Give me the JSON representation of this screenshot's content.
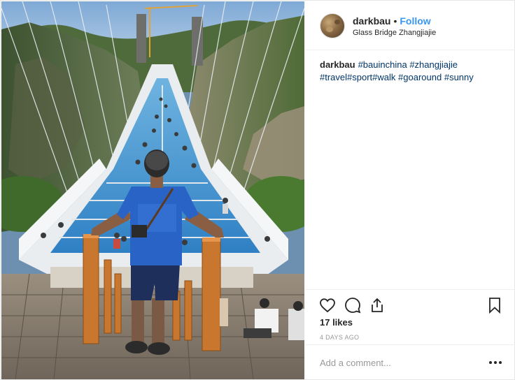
{
  "post": {
    "username": "darkbau",
    "separator": "•",
    "follow_label": "Follow",
    "location": "Glass Bridge Zhangjiajie",
    "avatar_icon": "avatar-photo",
    "photo_description_icon": "photo"
  },
  "caption": {
    "username": "darkbau",
    "hashtags": [
      "#bauinchina",
      "#zhangjiajie",
      "#travel",
      "#sport",
      "#walk",
      "#goaround",
      "#sunny"
    ]
  },
  "actions": {
    "like_icon": "heart-icon",
    "comment_icon": "comment-icon",
    "share_icon": "share-icon",
    "save_icon": "bookmark-icon"
  },
  "stats": {
    "likes": "17 likes",
    "time_ago": "4 DAYS AGO"
  },
  "comment": {
    "placeholder": "Add a comment...",
    "more_icon": "ellipsis-icon"
  },
  "colors": {
    "link": "#3897f0",
    "hashtag": "#003569",
    "border": "#efefef"
  }
}
